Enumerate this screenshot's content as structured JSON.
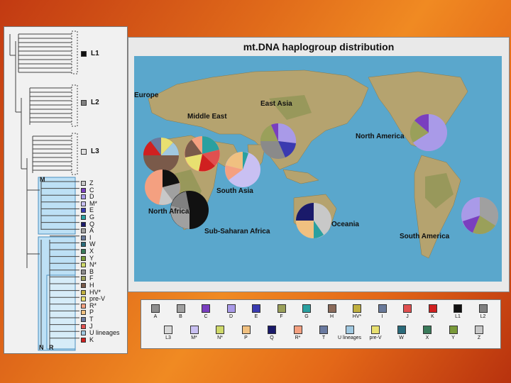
{
  "tree": {
    "major": [
      {
        "label": "L1",
        "color": "#111111"
      },
      {
        "label": "L2",
        "color": "#808080"
      },
      {
        "label": "L3",
        "color": "#e0e0e0"
      }
    ],
    "clade_labels": {
      "m": "M",
      "n": "N",
      "r": "R"
    },
    "leaves": [
      {
        "label": "Z",
        "color": "#c8c8c8"
      },
      {
        "label": "C",
        "color": "#7a3fbf"
      },
      {
        "label": "D",
        "color": "#a99ae8"
      },
      {
        "label": "M*",
        "color": "#c9c0f2"
      },
      {
        "label": "E",
        "color": "#3a3ab0"
      },
      {
        "label": "G",
        "color": "#2aa0a0"
      },
      {
        "label": "Q",
        "color": "#1a1a6a"
      },
      {
        "label": "A",
        "color": "#a0a0a0"
      },
      {
        "label": "I",
        "color": "#6a7a9a"
      },
      {
        "label": "W",
        "color": "#2a6a7a"
      },
      {
        "label": "X",
        "color": "#3a7a5a"
      },
      {
        "label": "Y",
        "color": "#7a9a3a"
      },
      {
        "label": "N*",
        "color": "#cfd96a"
      },
      {
        "label": "B",
        "color": "#8a8a8a"
      },
      {
        "label": "F",
        "color": "#9aa05a"
      },
      {
        "label": "H",
        "color": "#7a5a4a"
      },
      {
        "label": "HV*",
        "color": "#c0b040"
      },
      {
        "label": "pre-V",
        "color": "#e8e070"
      },
      {
        "label": "R*",
        "color": "#f4a080"
      },
      {
        "label": "P",
        "color": "#f0c080"
      },
      {
        "label": "T",
        "color": "#6a7aa0"
      },
      {
        "label": "J",
        "color": "#e05050"
      },
      {
        "label": "U lineages",
        "color": "#a0c8e0"
      },
      {
        "label": "K",
        "color": "#d02020"
      }
    ]
  },
  "map": {
    "title": "mt.DNA haplogroup distribution",
    "regions": [
      {
        "name": "Europe"
      },
      {
        "name": "Middle East"
      },
      {
        "name": "East Asia"
      },
      {
        "name": "North America"
      },
      {
        "name": "North Africa"
      },
      {
        "name": "South Asia"
      },
      {
        "name": "Oceania"
      },
      {
        "name": "Sub-Saharan Africa"
      },
      {
        "name": "South America"
      }
    ],
    "colors": {
      "ocean": "#5aa7cc",
      "land": "#b5a36f",
      "land_dark": "#7f8f4a"
    }
  },
  "legend": {
    "row1": [
      {
        "label": "A",
        "color": "#8e8e8e"
      },
      {
        "label": "B",
        "color": "#a0a0a0"
      },
      {
        "label": "C",
        "color": "#7a3fbf"
      },
      {
        "label": "D",
        "color": "#a99ae8"
      },
      {
        "label": "E",
        "color": "#3a3ab0"
      },
      {
        "label": "F",
        "color": "#9aa05a"
      },
      {
        "label": "G",
        "color": "#2aa0a0"
      },
      {
        "label": "H",
        "color": "#8a6a5a"
      },
      {
        "label": "HV*",
        "color": "#c0b040"
      },
      {
        "label": "I",
        "color": "#6a7a9a"
      },
      {
        "label": "J",
        "color": "#e05050"
      },
      {
        "label": "K",
        "color": "#d02020"
      },
      {
        "label": "L1",
        "color": "#111111"
      },
      {
        "label": "L2",
        "color": "#808080"
      }
    ],
    "row2": [
      {
        "label": "L3",
        "color": "#d8d8d8"
      },
      {
        "label": "M*",
        "color": "#c9c0f2"
      },
      {
        "label": "N*",
        "color": "#cfd96a"
      },
      {
        "label": "P",
        "color": "#f0c080"
      },
      {
        "label": "Q",
        "color": "#1a1a6a"
      },
      {
        "label": "R*",
        "color": "#f4a080"
      },
      {
        "label": "T",
        "color": "#6a7aa0"
      },
      {
        "label": "U lineages",
        "color": "#a0c8e0"
      },
      {
        "label": "pre-V",
        "color": "#e8e070"
      },
      {
        "label": "W",
        "color": "#2a6a7a"
      },
      {
        "label": "X",
        "color": "#3a7a5a"
      },
      {
        "label": "Y",
        "color": "#7a9a3a"
      },
      {
        "label": "Z",
        "color": "#c8c8c8"
      }
    ]
  }
}
